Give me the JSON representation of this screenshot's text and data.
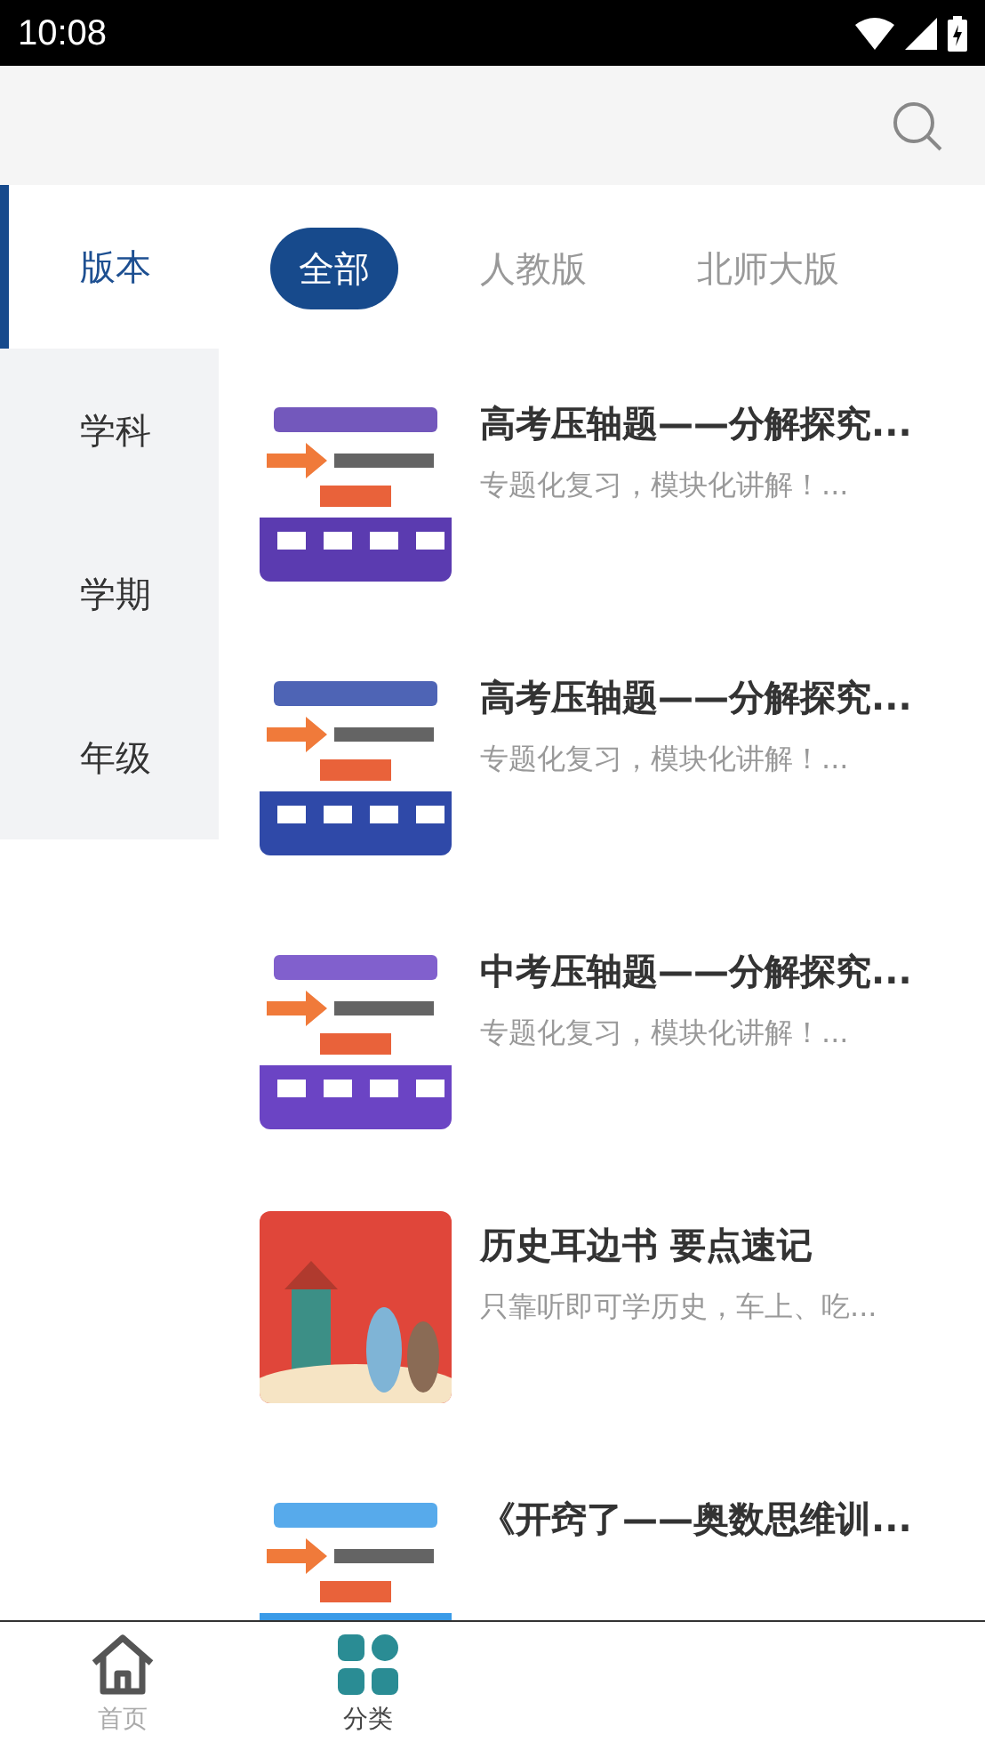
{
  "status_bar": {
    "time": "10:08"
  },
  "sidebar": {
    "items": [
      {
        "label": "版本",
        "selected": true
      },
      {
        "label": "学科",
        "selected": false
      },
      {
        "label": "学期",
        "selected": false
      },
      {
        "label": "年级",
        "selected": false
      }
    ]
  },
  "filters": [
    {
      "label": "全部",
      "selected": true
    },
    {
      "label": "人教版",
      "selected": false
    },
    {
      "label": "北师大版",
      "selected": false
    }
  ],
  "books": [
    {
      "title": "高考压轴题——分解探究...",
      "subtitle": "专题化复习，模块化讲解！..."
    },
    {
      "title": "高考压轴题——分解探究...",
      "subtitle": "专题化复习，模块化讲解！..."
    },
    {
      "title": "中考压轴题——分解探究...",
      "subtitle": "专题化复习，模块化讲解！..."
    },
    {
      "title": "历史耳边书 要点速记",
      "subtitle": "只靠听即可学历史，车上、吃..."
    },
    {
      "title": "《开窍了——奥数思维训..."
    }
  ],
  "bottom_nav": [
    {
      "label": "首页",
      "selected": false
    },
    {
      "label": "分类",
      "selected": true
    }
  ]
}
